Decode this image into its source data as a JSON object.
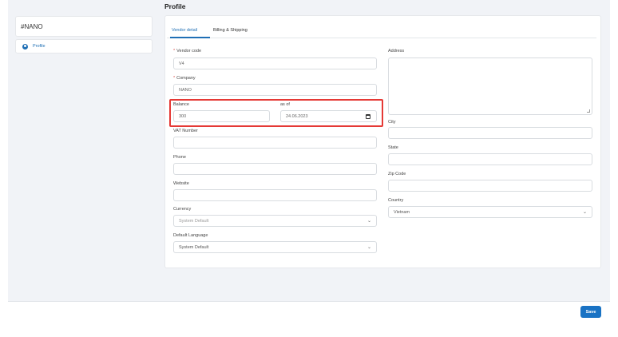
{
  "page": {
    "title": "Profile"
  },
  "sidebar": {
    "title": "#NANO",
    "items": [
      {
        "label": "Profile",
        "icon": "user-circle-icon"
      }
    ]
  },
  "tabs": [
    {
      "label": "Vendor detail"
    },
    {
      "label": "Billing & Shipping"
    }
  ],
  "form": {
    "vendor_code": {
      "label": "Vendor code",
      "value": "V4",
      "required": "*"
    },
    "company": {
      "label": "Company",
      "value": "NANO",
      "required": "*"
    },
    "balance": {
      "label": "Balance",
      "value": "300"
    },
    "as_of": {
      "label": "as of",
      "value": "24.06.2023"
    },
    "vat_number": {
      "label": "VAT Number",
      "value": ""
    },
    "phone": {
      "label": "Phone",
      "value": ""
    },
    "website": {
      "label": "Website",
      "value": ""
    },
    "currency": {
      "label": "Currency",
      "value": "System Default"
    },
    "default_language": {
      "label": "Default Language",
      "value": "System Default"
    },
    "address": {
      "label": "Address",
      "value": ""
    },
    "city": {
      "label": "City",
      "value": ""
    },
    "state": {
      "label": "State",
      "value": ""
    },
    "zip_code": {
      "label": "Zip Code",
      "value": ""
    },
    "country": {
      "label": "Country",
      "value": "Vietnam"
    }
  },
  "actions": {
    "save_label": "Save"
  },
  "colors": {
    "accent": "#1f6fb5",
    "highlight": "#e53935",
    "required": "#d9534f"
  }
}
